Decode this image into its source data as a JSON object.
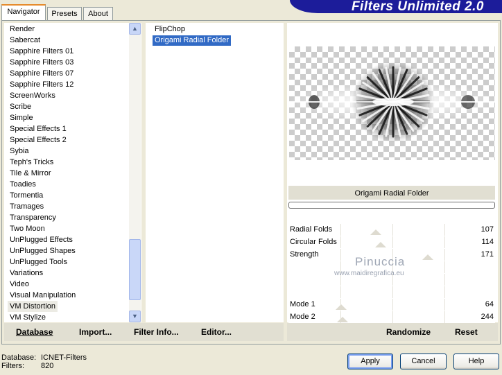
{
  "tabs": [
    {
      "label": "Navigator",
      "active": true
    },
    {
      "label": "Presets",
      "active": false
    },
    {
      "label": "About",
      "active": false
    }
  ],
  "banner": "Filters Unlimited 2.0",
  "categories": [
    "Render",
    "Sabercat",
    "Sapphire Filters 01",
    "Sapphire Filters 03",
    "Sapphire Filters 07",
    "Sapphire Filters 12",
    "ScreenWorks",
    "Scribe",
    "Simple",
    "Special Effects 1",
    "Special Effects 2",
    "Sybia",
    "Teph's Tricks",
    "Tile & Mirror",
    "Toadies",
    "Tormentia",
    "Tramages",
    "Transparency",
    "Two Moon",
    "UnPlugged Effects",
    "UnPlugged Shapes",
    "UnPlugged Tools",
    "Variations",
    "Video",
    "Visual Manipulation",
    "VM Distortion",
    "VM Stylize"
  ],
  "selected_category": "VM Distortion",
  "filters": [
    "FlipChop",
    "Origami Radial Folder"
  ],
  "selected_filter": "Origami Radial Folder",
  "filter_name": "Origami Radial Folder",
  "params": [
    {
      "label": "Radial Folds",
      "value": "107"
    },
    {
      "label": "Circular Folds",
      "value": "114"
    },
    {
      "label": "Strength",
      "value": "171"
    },
    {
      "label": "",
      "value": ""
    },
    {
      "label": "",
      "value": ""
    },
    {
      "label": "",
      "value": ""
    },
    {
      "label": "Mode 1",
      "value": "64"
    },
    {
      "label": "Mode 2",
      "value": "244"
    }
  ],
  "left_buttons": {
    "database": "Database",
    "import": "Import...",
    "filter_info": "Filter Info...",
    "editor": "Editor..."
  },
  "right_buttons": {
    "randomize": "Randomize",
    "reset": "Reset"
  },
  "status": {
    "database_label": "Database:",
    "database_value": "ICNET-Filters",
    "filters_label": "Filters:",
    "filters_value": "820"
  },
  "dialog_buttons": {
    "apply": "Apply",
    "cancel": "Cancel",
    "help": "Help"
  },
  "watermark": {
    "name": "Pinuccia",
    "url": "www.maidiregrafica.eu"
  },
  "icons": {
    "scroll_up": "scroll-up-arrow-icon",
    "scroll_down": "scroll-down-arrow-icon"
  },
  "colors": {
    "selection": "#316ac5",
    "banner": "#1c1c9a",
    "tab_highlight": "#e68b2c"
  }
}
